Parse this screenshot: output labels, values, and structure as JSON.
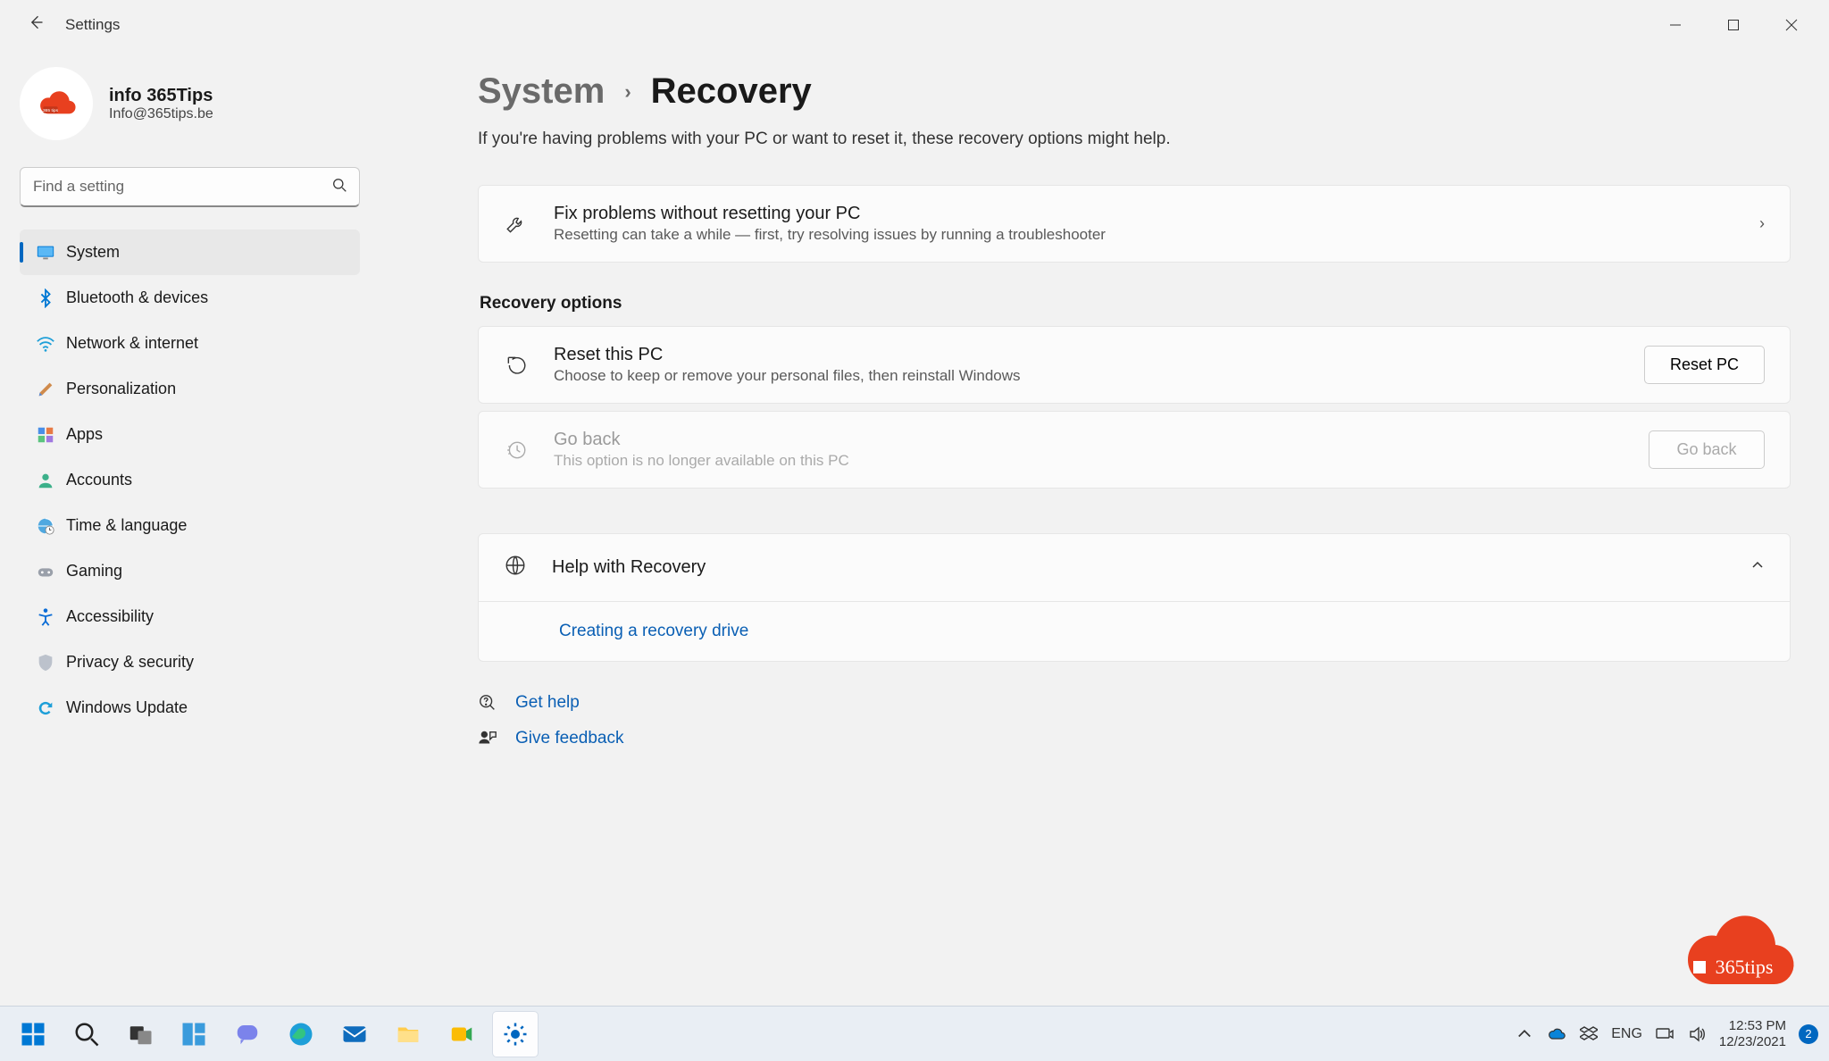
{
  "window": {
    "title": "Settings"
  },
  "user": {
    "name": "info 365Tips",
    "email": "Info@365tips.be"
  },
  "search": {
    "placeholder": "Find a setting"
  },
  "sidebar": {
    "items": [
      {
        "label": "System"
      },
      {
        "label": "Bluetooth & devices"
      },
      {
        "label": "Network & internet"
      },
      {
        "label": "Personalization"
      },
      {
        "label": "Apps"
      },
      {
        "label": "Accounts"
      },
      {
        "label": "Time & language"
      },
      {
        "label": "Gaming"
      },
      {
        "label": "Accessibility"
      },
      {
        "label": "Privacy & security"
      },
      {
        "label": "Windows Update"
      }
    ]
  },
  "breadcrumb": {
    "parent": "System",
    "current": "Recovery"
  },
  "intro": "If you're having problems with your PC or want to reset it, these recovery options might help.",
  "cards": {
    "fix": {
      "title": "Fix problems without resetting your PC",
      "sub": "Resetting can take a while — first, try resolving issues by running a troubleshooter"
    },
    "section_title": "Recovery options",
    "reset": {
      "title": "Reset this PC",
      "sub": "Choose to keep or remove your personal files, then reinstall Windows",
      "button": "Reset PC"
    },
    "goback": {
      "title": "Go back",
      "sub": "This option is no longer available on this PC",
      "button": "Go back"
    },
    "help": {
      "title": "Help with Recovery",
      "link": "Creating a recovery drive"
    }
  },
  "footer": {
    "help": "Get help",
    "feedback": "Give feedback"
  },
  "watermark": "365tips",
  "tray": {
    "lang": "ENG",
    "time": "12:53 PM",
    "date": "12/23/2021",
    "badge": "2"
  }
}
